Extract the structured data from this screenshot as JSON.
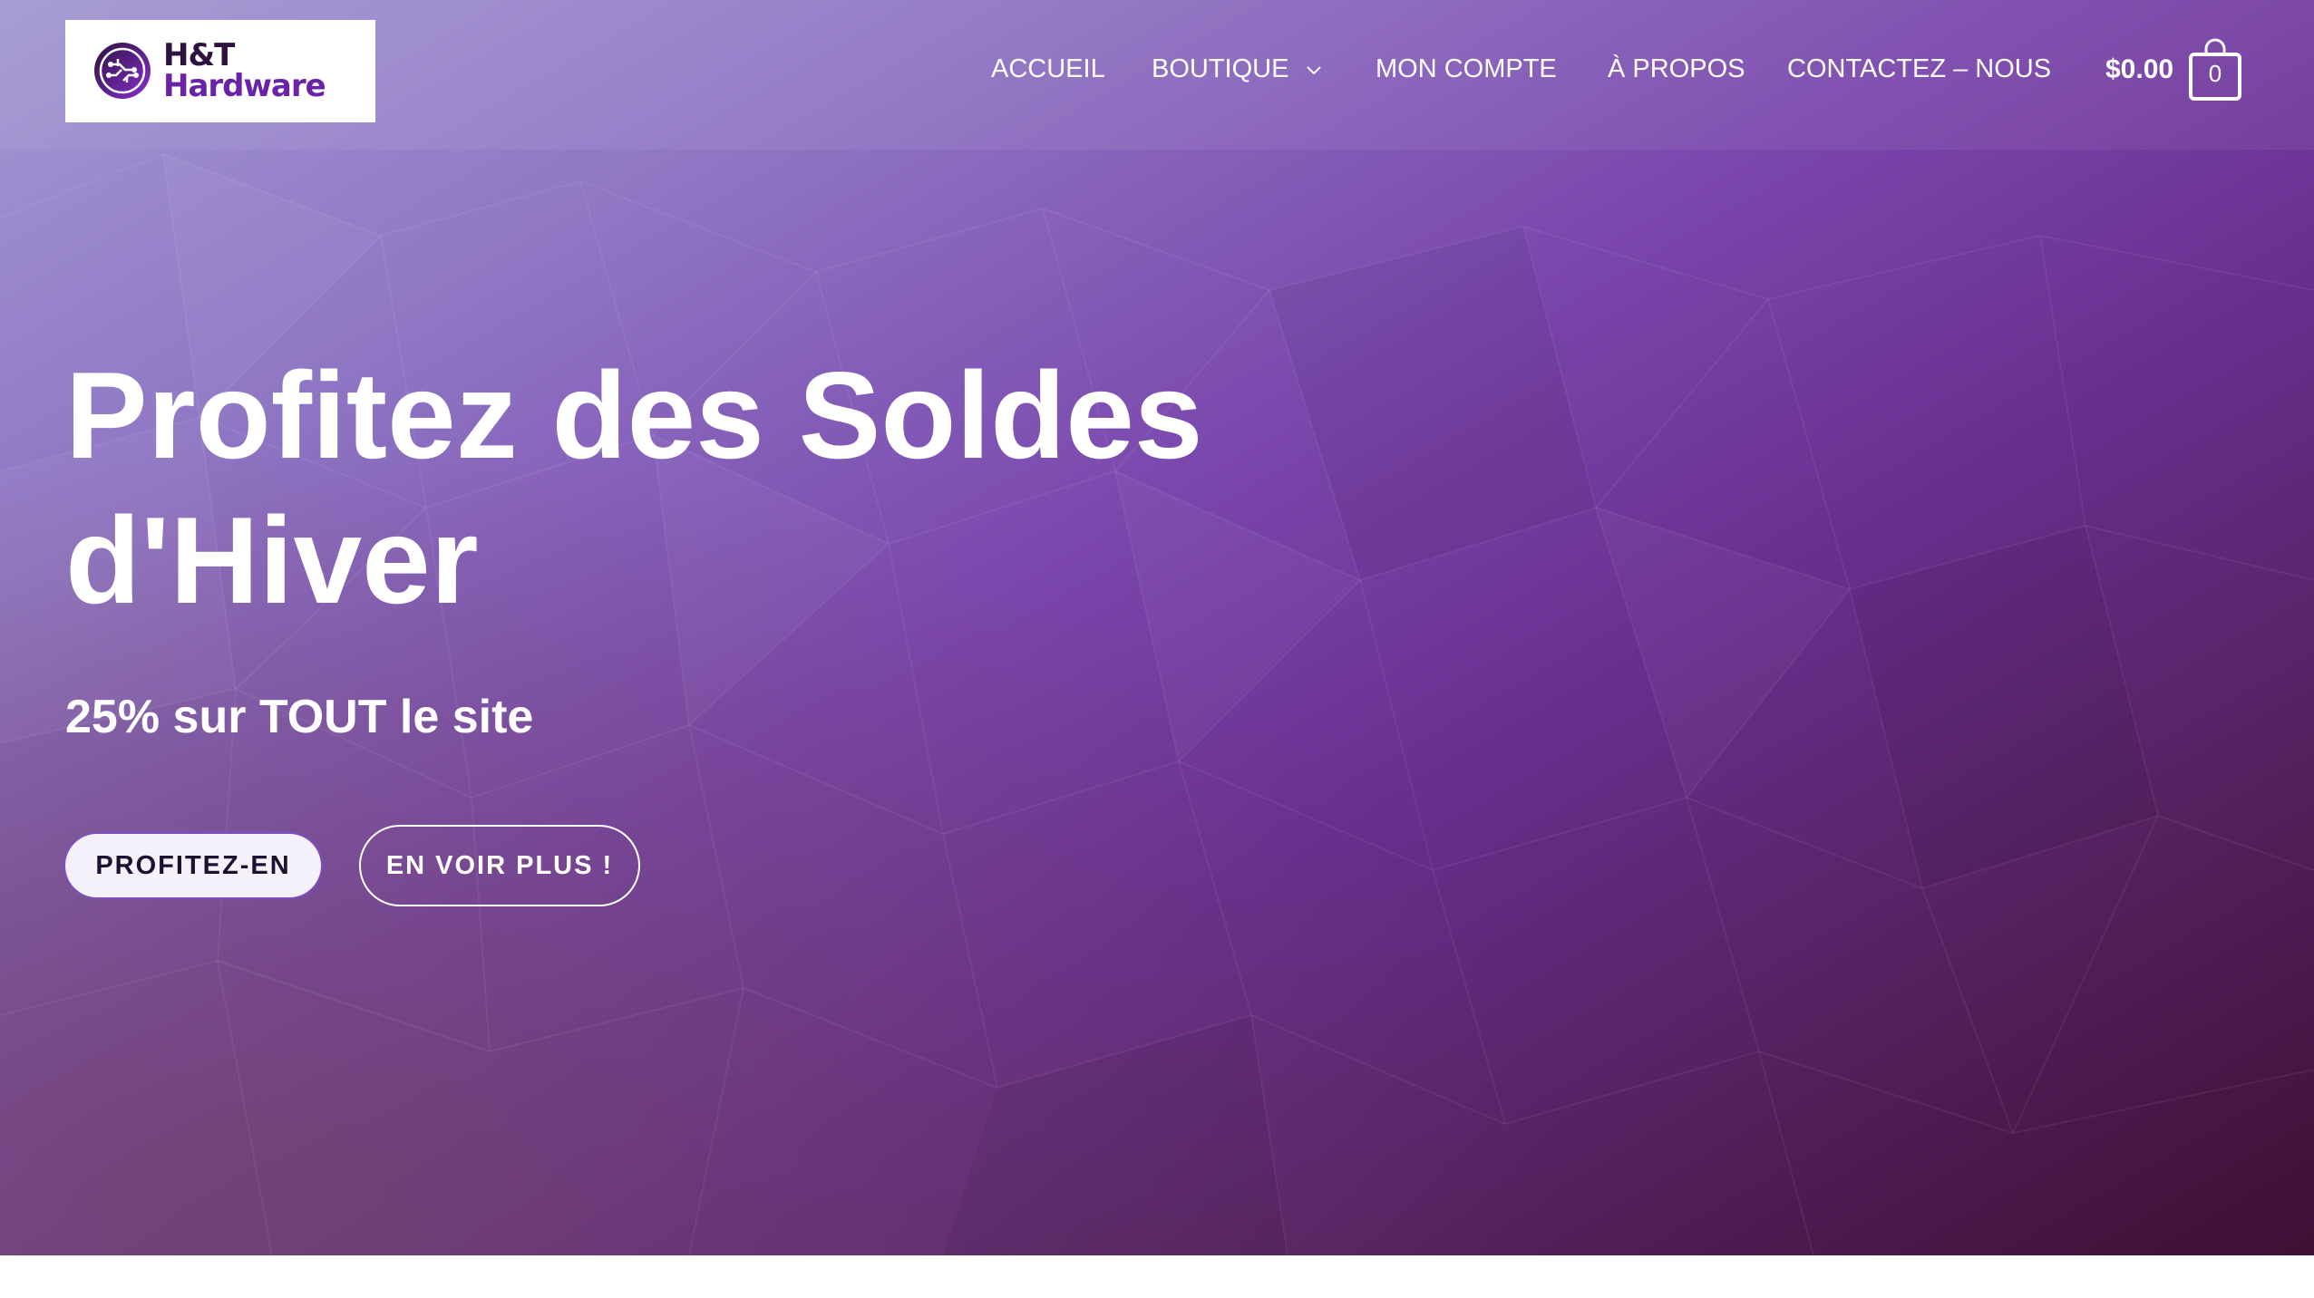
{
  "header": {
    "logo": {
      "line1": "H&T",
      "line2": "Hardware"
    },
    "nav": [
      {
        "label": "ACCUEIL"
      },
      {
        "label": "BOUTIQUE",
        "has_dropdown": true
      },
      {
        "label": "MON COMPTE"
      },
      {
        "label": "À PROPOS"
      },
      {
        "label": "CONTACTEZ – NOUS"
      }
    ],
    "cart": {
      "amount": "$0.00",
      "count": "0"
    }
  },
  "hero": {
    "title_line1": "Profitez des Soldes",
    "title_line2": "d'Hiver",
    "subtitle": "25% sur TOUT le site",
    "primary_button": "PROFITEZ-EN",
    "secondary_button": "EN VOIR PLUS !"
  },
  "colors": {
    "brand_purple": "#6a22a8",
    "hero_start": "#a397d2",
    "hero_end": "#3f0f33"
  }
}
